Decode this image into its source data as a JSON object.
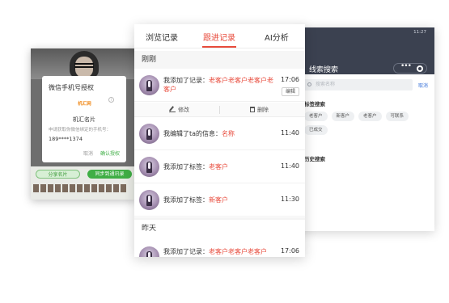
{
  "left_phone": {
    "dialog_title": "微信手机号授权",
    "logo_text": "机汇网",
    "app_name": "机汇名片",
    "description": "申请获取你微信绑定的手机号：",
    "phone_number": "189****1374",
    "cancel_label": "取消",
    "confirm_label": "确认授权",
    "share_button": "分享名片",
    "sync_button": "同步到通讯录"
  },
  "right_phone": {
    "status_time": "11:27",
    "title": "线索搜索",
    "search_placeholder": "搜索名称",
    "cancel_label": "取消",
    "tags_heading": "标签搜索",
    "tags": [
      "老客户",
      "新客户",
      "老客户",
      "可联系",
      "已成交"
    ],
    "history_heading": "历史搜索"
  },
  "center_phone": {
    "tabs": [
      {
        "label": "浏览记录",
        "active": false
      },
      {
        "label": "跟进记录",
        "active": true
      },
      {
        "label": "AI分析",
        "active": false
      }
    ],
    "groups": [
      {
        "label": "刚刚"
      },
      {
        "label": "昨天"
      }
    ],
    "records": [
      {
        "prefix": "我添加了记录：",
        "highlight": "老客户老客户老客户老客户",
        "time": "17:06",
        "badge": "编辑"
      },
      {
        "prefix": "我编辑了ta的信息：",
        "highlight": "名称",
        "time": "11:40"
      },
      {
        "prefix": "我添加了标签：",
        "highlight": "老客户",
        "time": "11:40"
      },
      {
        "prefix": "我添加了标签：",
        "highlight": "新客户",
        "time": "11:30"
      },
      {
        "prefix": "我添加了记录：",
        "highlight": "老客户老客户老客户",
        "time": "17:06"
      }
    ],
    "actions": {
      "modify": "修改",
      "delete": "删除"
    }
  },
  "colors": {
    "accent": "#e84b3c",
    "confirm_green": "#3fae45",
    "right_header": "#3b4150",
    "link_blue": "#3a73d9"
  }
}
